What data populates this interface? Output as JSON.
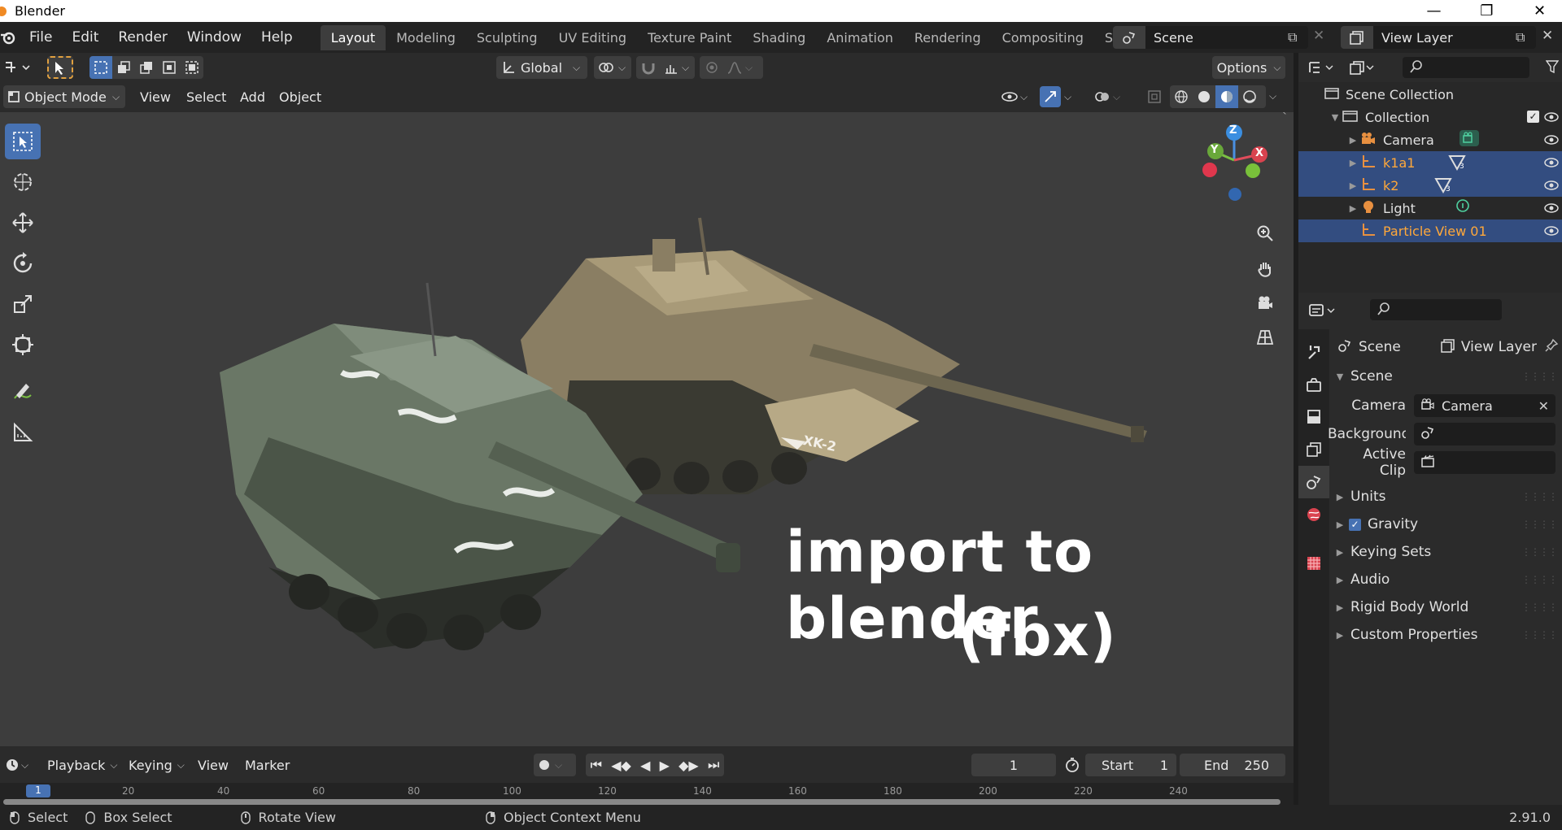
{
  "window": {
    "title": "Blender"
  },
  "menus": [
    "File",
    "Edit",
    "Render",
    "Window",
    "Help"
  ],
  "workspaces": [
    "Layout",
    "Modeling",
    "Sculpting",
    "UV Editing",
    "Texture Paint",
    "Shading",
    "Animation",
    "Rendering",
    "Compositing",
    "Scripting"
  ],
  "scene_selector": {
    "value": "Scene"
  },
  "view_layer_selector": {
    "value": "View Layer"
  },
  "toolbar": {
    "transform_orientation": "Global",
    "options_label": "Options"
  },
  "viewport_header": {
    "mode": "Object Mode",
    "view": "View",
    "select": "Select",
    "add": "Add",
    "object": "Object"
  },
  "navigation_gizmo": {
    "z": "Z",
    "y": "Y",
    "x": "X"
  },
  "overlay_text": {
    "line1": "import to blender",
    "line2": "(fbx)"
  },
  "tank_labels": {
    "k2": "XK-2"
  },
  "timeline": {
    "playback": "Playback",
    "keying": "Keying",
    "view": "View",
    "marker": "Marker",
    "current_frame": "1",
    "start_label": "Start",
    "start_value": "1",
    "end_label": "End",
    "end_value": "250",
    "ruler_ticks": [
      "20",
      "40",
      "60",
      "80",
      "100",
      "120",
      "140",
      "160",
      "180",
      "200",
      "220",
      "240"
    ],
    "current_marker": "1"
  },
  "status": {
    "select": "Select",
    "box_select": "Box Select",
    "rotate_view": "Rotate View",
    "context_menu": "Object Context Menu",
    "version": "2.91.0"
  },
  "outliner": {
    "scene_collection": "Scene Collection",
    "collection": "Collection",
    "items": [
      {
        "label": "Camera",
        "selected": false,
        "orange": false
      },
      {
        "label": "k1a1",
        "selected": true,
        "orange": true,
        "badge": "3"
      },
      {
        "label": "k2",
        "selected": true,
        "orange": true,
        "badge": "3"
      },
      {
        "label": "Light",
        "selected": false,
        "orange": false
      },
      {
        "label": "Particle View 01",
        "selected": true,
        "orange": true
      }
    ]
  },
  "properties": {
    "breadcrumb_scene": "Scene",
    "breadcrumb_view_layer": "View Layer",
    "panel_title": "Scene",
    "camera_label": "Camera",
    "camera_value": "Camera",
    "background_label": "Background ...",
    "active_clip_label": "Active Clip",
    "sections": [
      "Units",
      "Gravity",
      "Keying Sets",
      "Audio",
      "Rigid Body World",
      "Custom Properties"
    ],
    "gravity_checked": true
  },
  "colors": {
    "accent": "#4772b3",
    "selected_row": "#334d80",
    "orange": "#ffa83a",
    "viewport_bg": "#3d3d3d"
  }
}
